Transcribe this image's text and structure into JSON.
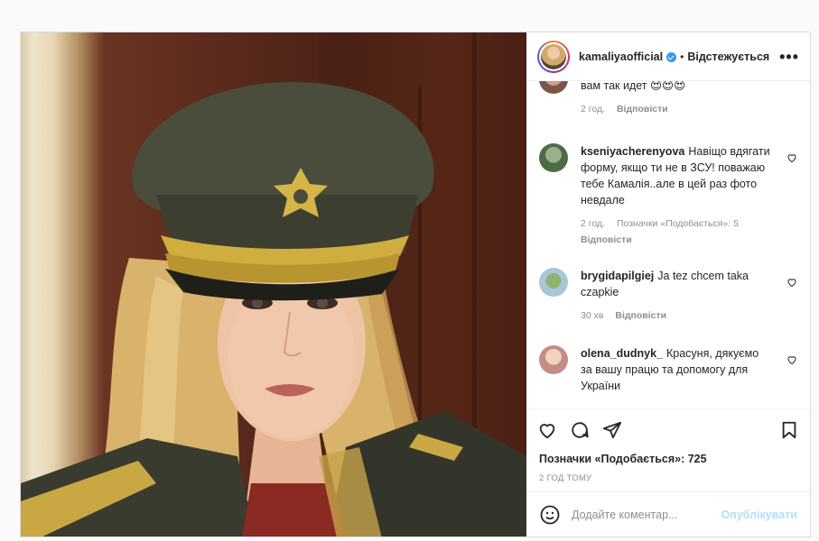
{
  "post": {
    "username": "kamaliyaofficial",
    "separator": "•",
    "follow_label": "Відстежується",
    "more_label": "•••"
  },
  "comments": [
    {
      "user": "",
      "text": "вам так идет 😍😍😍",
      "time": "2 год.",
      "likes": "",
      "reply": "Відповісти"
    },
    {
      "user": "kseniyacherenyova",
      "text": "Навіщо вдягати форму, якщо ти не в ЗСУ! поважаю тебе Камалія..але в цей раз фото невдале",
      "time": "2 год.",
      "likes": "Позначки «Подобається»: 5",
      "reply": "Відповісти"
    },
    {
      "user": "brygidapilgiej",
      "text": "Ja tez chcem taka czapkie",
      "time": "30 хв",
      "likes": "",
      "reply": "Відповісти"
    },
    {
      "user": "olena_dudnyk_",
      "text": "Красуня, дякуємо за вашу працю та допомогу для України",
      "time": "",
      "likes": "",
      "reply": ""
    }
  ],
  "likes_text": "Позначки «Подобається»: 725",
  "time_ago": "2 ГОД ТОМУ",
  "add_comment": {
    "placeholder": "Додайте коментар...",
    "publish_label": "Опублікувати"
  },
  "colors": {
    "accent": "#3897f0",
    "publish_disabled": "#b2dffc",
    "muted": "#8e8e8e"
  },
  "icons": [
    "heart-icon",
    "comment-icon",
    "share-icon",
    "bookmark-icon",
    "emoji-icon",
    "more-icon",
    "verified-icon"
  ]
}
